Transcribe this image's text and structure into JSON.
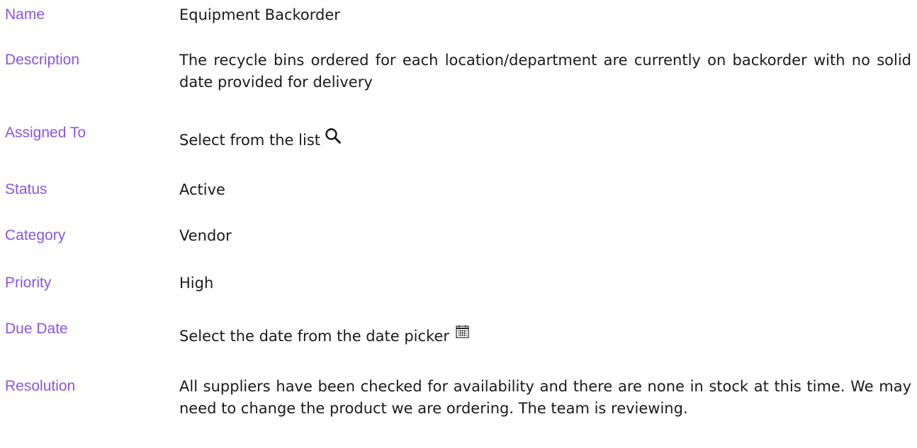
{
  "fields": {
    "name": {
      "label": "Name",
      "value": "Equipment Backorder"
    },
    "description": {
      "label": "Description",
      "value": "The recycle bins ordered for each location/department are currently on backorder with no solid date provided for delivery"
    },
    "assigned_to": {
      "label": "Assigned To",
      "value": "Select from the list",
      "icon": "search-icon"
    },
    "status": {
      "label": "Status",
      "value": "Active"
    },
    "category": {
      "label": "Category",
      "value": "Vendor"
    },
    "priority": {
      "label": "Priority",
      "value": "High"
    },
    "due_date": {
      "label": "Due Date",
      "value": "Select the date from the date picker",
      "icon": "calendar-icon"
    },
    "resolution": {
      "label": "Resolution",
      "value": "All suppliers have been checked for availability and there are none in stock at this time. We may need to change the product we are ordering. The team is reviewing."
    }
  },
  "colors": {
    "label": "#8b55e0",
    "value": "#1a1a1a"
  }
}
